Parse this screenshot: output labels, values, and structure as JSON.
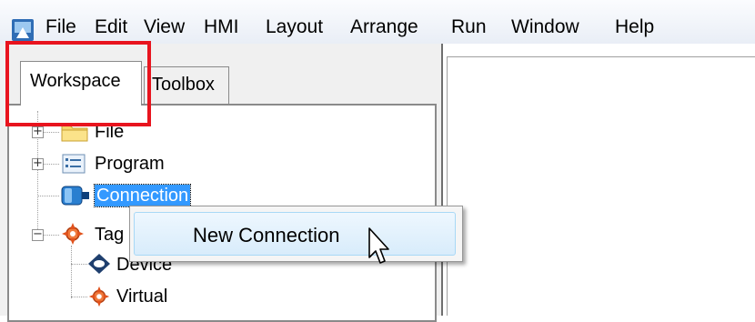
{
  "menubar": {
    "items": [
      "File",
      "Edit",
      "View",
      "HMI",
      "Layout",
      "Arrange",
      "Run",
      "Window",
      "Help"
    ]
  },
  "tabs": {
    "workspace": "Workspace",
    "toolbox": "Toolbox"
  },
  "tree": {
    "items": [
      "File",
      "Program",
      "Connection",
      "Tag",
      "Device",
      "Virtual"
    ],
    "selected": "Connection"
  },
  "context_menu": {
    "new_connection": "New Connection"
  },
  "colors": {
    "highlight": "#e8141e",
    "selection": "#3399ff",
    "menu_hover": "#d8ecfb"
  },
  "icons": {
    "app": "app-icon",
    "file": "folder-icon",
    "program": "program-list-icon",
    "connection": "connection-icon",
    "tag": "tag-icon",
    "device": "device-icon",
    "virtual": "virtual-tag-icon",
    "cursor": "mouse-pointer-icon"
  }
}
